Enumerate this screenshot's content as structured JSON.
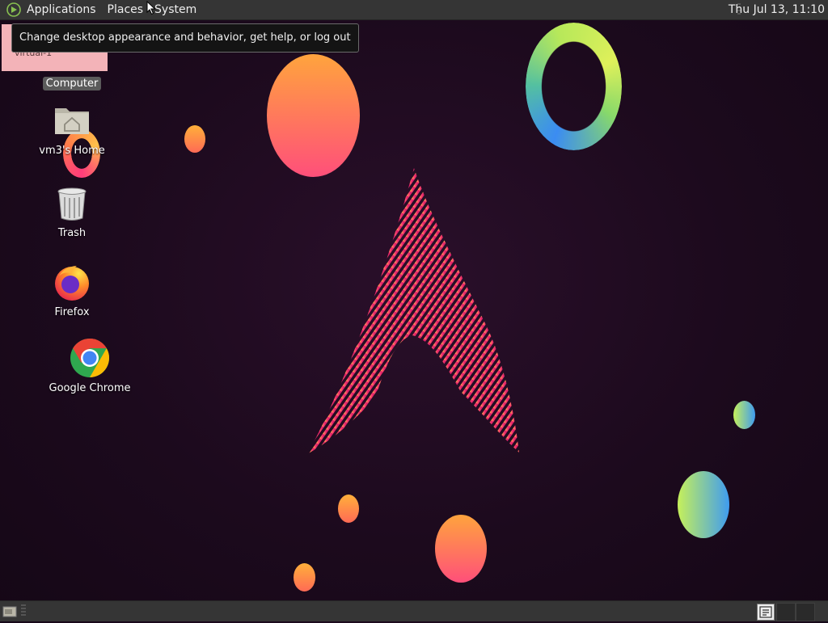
{
  "top_panel": {
    "menus": [
      {
        "label": "Applications"
      },
      {
        "label": "Places"
      },
      {
        "label": "System"
      }
    ],
    "clock": "Thu Jul 13, 11:10"
  },
  "tooltip": {
    "text": "Change desktop appearance and behavior, get help, or log out"
  },
  "pink_window": {
    "label": "virtual-1"
  },
  "desktop_icons": [
    {
      "label": "Computer",
      "icon": "computer-icon"
    },
    {
      "label": "vm3's Home",
      "icon": "home-folder-icon"
    },
    {
      "label": "Trash",
      "icon": "trash-icon"
    },
    {
      "label": "Firefox",
      "icon": "firefox-icon"
    },
    {
      "label": "Google Chrome",
      "icon": "chrome-icon"
    }
  ],
  "bottom_panel": {
    "show_desktop_icon": "show-desktop-icon",
    "tray_icon": "tray-app-icon"
  }
}
